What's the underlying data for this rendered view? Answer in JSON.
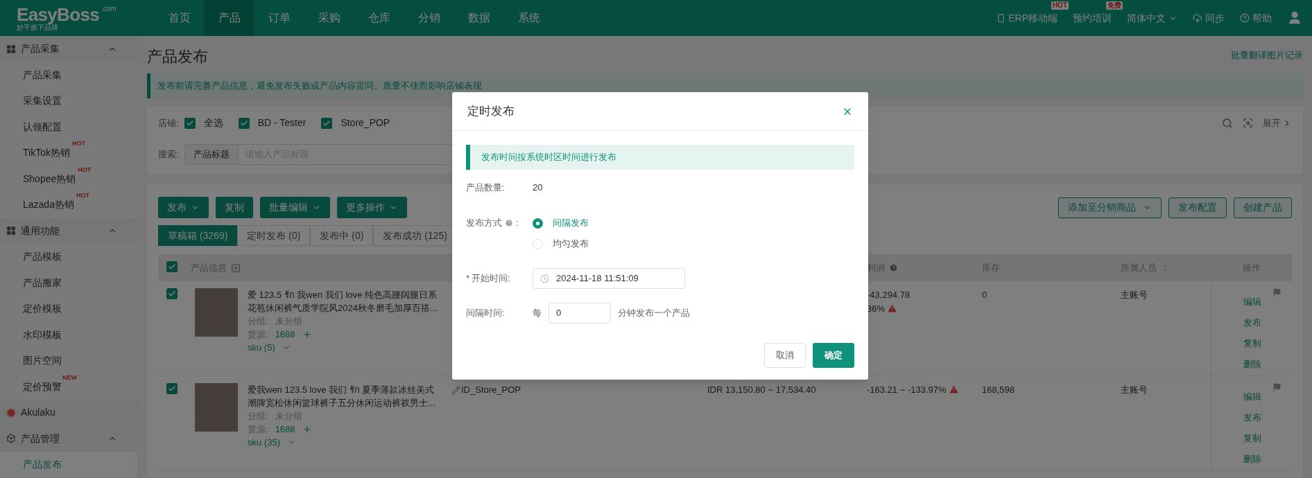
{
  "top_nav": {
    "logo": "EasyBoss",
    "logo_domain": ".com",
    "logo_tagline": "妙手旗下品牌",
    "items": [
      {
        "label": "首页",
        "selected": false
      },
      {
        "label": "产品",
        "selected": true
      },
      {
        "label": "订单",
        "selected": false
      },
      {
        "label": "采购",
        "selected": false
      },
      {
        "label": "仓库",
        "selected": false
      },
      {
        "label": "分销",
        "selected": false
      },
      {
        "label": "数据",
        "selected": false
      },
      {
        "label": "系统",
        "selected": false
      }
    ],
    "right": [
      {
        "kind": "mobile",
        "label": "ERP移动端",
        "badge": "HOT"
      },
      {
        "kind": "plain",
        "label": "预约培训",
        "badge": "免费"
      },
      {
        "kind": "dropdown",
        "label": "简体中文"
      },
      {
        "kind": "cloud",
        "label": "同步"
      },
      {
        "kind": "help",
        "label": "帮助"
      },
      {
        "kind": "user"
      }
    ]
  },
  "sidebar": [
    {
      "kind": "group",
      "title": "产品采集",
      "expanded": true,
      "children": [
        {
          "label": "产品采集",
          "selected": false
        },
        {
          "label": "采集设置",
          "selected": false
        },
        {
          "label": "认领配置",
          "selected": false
        },
        {
          "label": "TikTok热销",
          "badge": "HOT",
          "selected": false
        },
        {
          "label": "Shopee热销",
          "badge": "HOT",
          "selected": false
        },
        {
          "label": "Lazada热销",
          "badge": "HOT",
          "selected": false
        }
      ]
    },
    {
      "kind": "group",
      "title": "通用功能",
      "expanded": true,
      "children": [
        {
          "label": "产品模板",
          "selected": false
        },
        {
          "label": "产品搬家",
          "selected": false
        },
        {
          "label": "定价模板",
          "selected": false
        },
        {
          "label": "水印模板",
          "selected": false
        },
        {
          "label": "图片空间",
          "selected": false
        },
        {
          "label": "定价预警",
          "badge": "NEW",
          "selected": false
        }
      ]
    },
    {
      "kind": "link",
      "title": "Akulaku"
    },
    {
      "kind": "box",
      "title": "产品管理",
      "expanded": true,
      "children": [
        {
          "label": "产品发布",
          "selected": true
        }
      ]
    }
  ],
  "page": {
    "title": "产品发布",
    "header_link": "批量翻译图片记录",
    "notice": "发布前请完善产品信息，避免发布失败或产品内容雷同、质量不佳而影响店铺表现"
  },
  "filters": {
    "store_label": "店铺:",
    "stores": [
      {
        "label": "全选",
        "checked": true
      },
      {
        "label": "BD - Tester",
        "checked": true
      },
      {
        "label": "Store_POP",
        "checked": true
      }
    ],
    "search_label": "搜索:",
    "search_type": "产品标题",
    "placeholder": "请输入产品标题",
    "expand": "展开"
  },
  "actions": [
    {
      "label": "发布",
      "dropdown": true
    },
    {
      "label": "复制",
      "dropdown": false
    },
    {
      "label": "批量编辑",
      "dropdown": true
    },
    {
      "label": "更多操作",
      "dropdown": true
    }
  ],
  "right_actions": [
    {
      "label": "添加至分销商品",
      "dropdown": true
    },
    {
      "label": "发布配置",
      "dropdown": false
    },
    {
      "label": "创建产品",
      "dropdown": false
    }
  ],
  "tabs": [
    {
      "label": "草稿箱 (3269)",
      "selected": true
    },
    {
      "label": "定时发布 (0)",
      "selected": false
    },
    {
      "label": "发布中 (0)",
      "selected": false
    },
    {
      "label": "发布成功 (125)",
      "selected": false
    }
  ],
  "table": {
    "all_checked": true,
    "columns": [
      {
        "label": "产品信息",
        "kind": "expand"
      },
      {
        "label": "利润",
        "kind": "help"
      },
      {
        "label": "库存",
        "kind": "plain"
      },
      {
        "label": "所属人员",
        "kind": "sort"
      },
      {
        "label": "操作",
        "kind": "plain"
      }
    ],
    "rows": [
      {
        "checked": true,
        "title": "爱 123.5 รัก 我wen 我们 love 纯色高腰阔腿日系花苞休闲裤气质学院风2024秋冬磨毛加厚百搭...",
        "group_label": "分组:",
        "group": "未分组",
        "source_label": "货源:",
        "source": "1688",
        "sku": "sku (5)",
        "profit": [
          "-43,294.78",
          "36%"
        ],
        "warning": true,
        "stock": "0",
        "owner": "主账号",
        "ops": [
          "编辑",
          "发布",
          "复制",
          "删除"
        ]
      },
      {
        "checked": true,
        "title": "爱我wen 123.5 love 我们 รัก 夏季薄款冰丝美式潮牌宽松休闲篮球裤子五分休闲运动裤衩男士...",
        "group_label": "分组:",
        "group": "未分组",
        "source_label": "货源:",
        "source": "1688",
        "sku": "sku (35)",
        "store": "ID_Store_POP",
        "price": "IDR 13,150.80 ~ 17,534.40",
        "profit": [
          "-163.21 ~ -133.97%"
        ],
        "warning": true,
        "stock": "168,598",
        "owner": "主账号",
        "ops": [
          "编辑",
          "发布",
          "复制",
          "删除"
        ]
      }
    ]
  },
  "modal": {
    "title": "定时发布",
    "info": "发布时间按系统时区时间进行发布",
    "fields": [
      {
        "kind": "count",
        "label": "产品数量:",
        "value": "20"
      },
      {
        "kind": "radio",
        "label": "发布方式",
        "colon": ":",
        "options": [
          {
            "label": "间隔发布",
            "selected": true
          },
          {
            "label": "均匀发布",
            "selected": false
          }
        ]
      },
      {
        "kind": "datetime",
        "required_mark": "*",
        "label": "开始时间:",
        "value": "2024-11-18 11:51:09"
      },
      {
        "kind": "interval",
        "label": "间隔时间:",
        "prefix": "每",
        "value": "0",
        "suffix": "分钟发布一个产品"
      }
    ],
    "buttons": [
      {
        "label": "取消",
        "kind": "secondary"
      },
      {
        "label": "确定",
        "kind": "primary"
      }
    ]
  }
}
